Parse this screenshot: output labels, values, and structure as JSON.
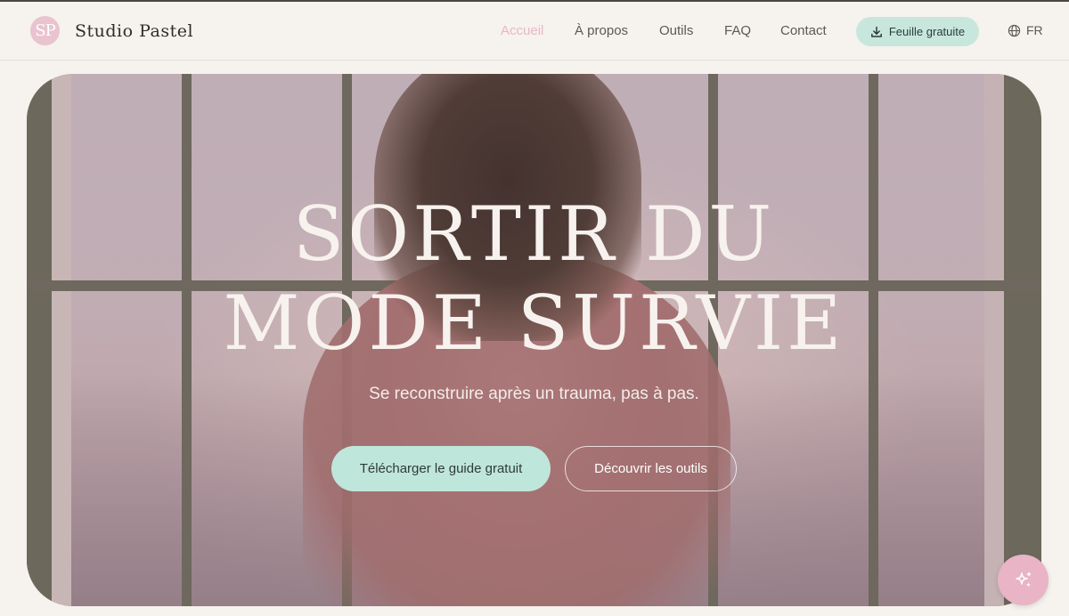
{
  "brand": {
    "logo_text": "SP",
    "name": "Studio Pastel"
  },
  "nav": {
    "items": [
      {
        "label": "Accueil",
        "active": true
      },
      {
        "label": "À propos",
        "active": false
      },
      {
        "label": "Outils",
        "active": false
      },
      {
        "label": "FAQ",
        "active": false
      },
      {
        "label": "Contact",
        "active": false
      }
    ],
    "cta_label": "Feuille gratuite",
    "cta_icon": "download-icon",
    "language": {
      "label": "FR",
      "icon": "globe-icon"
    }
  },
  "hero": {
    "title_line1": "SORTIR DU",
    "title_line2": "MODE SURVIE",
    "subtitle": "Se reconstruire après un trauma, pas à pas.",
    "primary_button": "Télécharger le guide gratuit",
    "secondary_button": "Découvrir les outils",
    "background_image": "woman-at-window-photo"
  },
  "fab": {
    "icon": "sparkles-icon"
  },
  "colors": {
    "background": "#f6f2ee",
    "accent_pink": "#e7b7c7",
    "accent_mint": "#c7e7dd",
    "text": "#3e3b3a"
  }
}
